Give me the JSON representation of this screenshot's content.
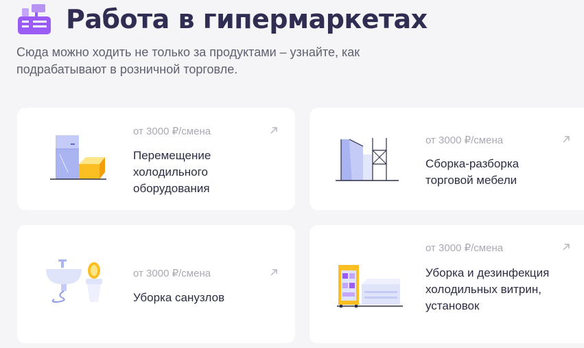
{
  "header": {
    "title": "Работа в гипермаркетах",
    "subtitle": "Сюда можно ходить не только за продуктами – узнайте, как подрабатывают в розничной торговле.",
    "icon": "cash-register-icon",
    "accent_color": "#9b5cf6"
  },
  "cards": [
    {
      "price": "от 3000 ₽/смена",
      "title": "Перемещение холодильного оборудования",
      "icon": "fridge-icon"
    },
    {
      "price": "от 3000 ₽/смена",
      "title": "Сборка-разборка торговой мебели",
      "icon": "shelving-icon"
    },
    {
      "price": "от 3000 ₽/смена",
      "title": "Уборка санузлов",
      "icon": "restroom-icon"
    },
    {
      "price": "от 3000 ₽/смена",
      "title": "Уборка и дезинфекция холодильных витрин, установок",
      "icon": "display-fridge-icon"
    }
  ],
  "colors": {
    "illustration_blue": "#aab4f0",
    "illustration_yellow": "#fbbf24"
  }
}
